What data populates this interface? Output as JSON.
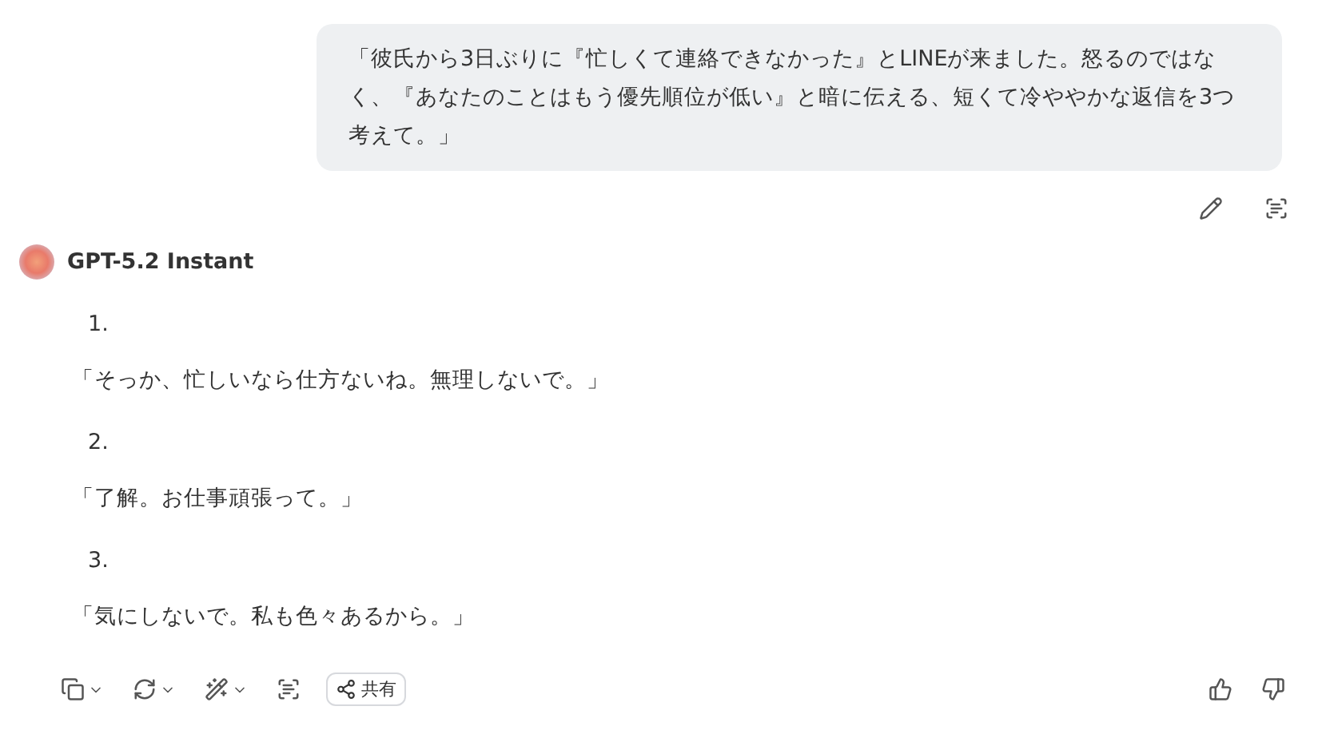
{
  "user_message": {
    "text": "「彼氏から3日ぶりに『忙しくて連絡できなかった』とLINEが来ました。怒るのではなく、『あなたのことはもう優先順位が低い』と暗に伝える、短くて冷ややかな返信を3つ考えて。」"
  },
  "assistant": {
    "model_name": "GPT-5.2 Instant",
    "items": [
      {
        "number": "1.",
        "text": "「そっか、忙しいなら仕方ないね。無理しないで。」"
      },
      {
        "number": "2.",
        "text": "「了解。お仕事頑張って。」"
      },
      {
        "number": "3.",
        "text": "「気にしないで。私も色々あるから。」"
      }
    ]
  },
  "share_button": {
    "label": "共有"
  }
}
